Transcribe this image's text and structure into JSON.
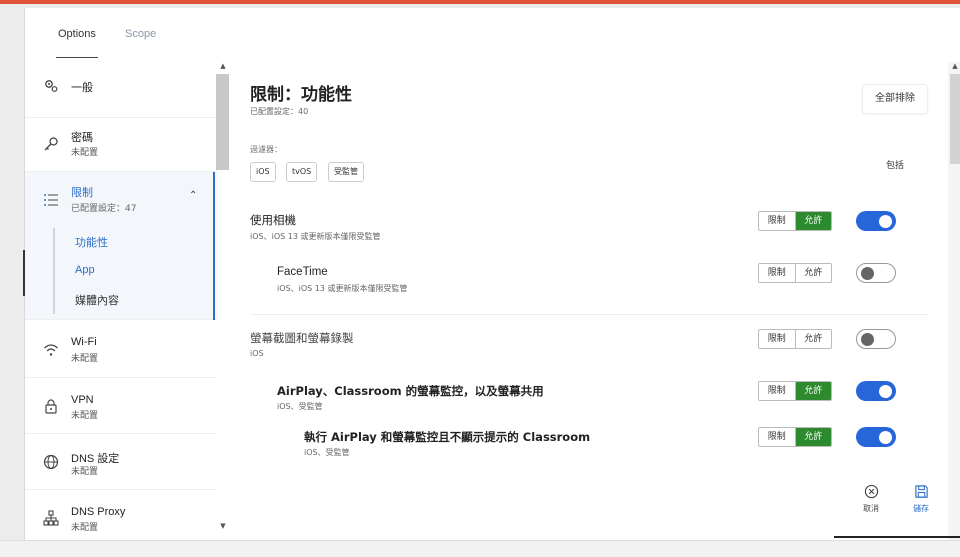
{
  "tabs": {
    "options": "Options",
    "scope": "Scope"
  },
  "sidebar": {
    "items": [
      {
        "title": "一般",
        "sub": "",
        "icon": "gears-icon"
      },
      {
        "title": "密碼",
        "sub": "未配置",
        "icon": "key-icon"
      },
      {
        "title": "限制",
        "sub": "已配置設定：47",
        "icon": "list-icon"
      },
      {
        "title": "Wi-Fi",
        "sub": "未配置",
        "icon": "wifi-icon"
      },
      {
        "title": "VPN",
        "sub": "未配置",
        "icon": "lock-icon"
      },
      {
        "title": "DNS 設定",
        "sub": "未配置",
        "icon": "globe-icon"
      },
      {
        "title": "DNS Proxy",
        "sub": "未配置",
        "icon": "network-icon"
      }
    ],
    "sub_items": [
      "功能性",
      "App",
      "媒體內容"
    ]
  },
  "main": {
    "title": "限制：功能性",
    "subtitle": "已配置設定：40",
    "clear_all": "全部排除",
    "filter_label": "過濾器：",
    "filters": [
      "iOS",
      "tvOS",
      "受監管"
    ],
    "include_label": "包括",
    "restrict_label": "限制",
    "allow_label": "允許",
    "rows": [
      {
        "title": "使用相機",
        "sub": "iOS、iOS 13 或更新版本僅限受監管",
        "allow": true,
        "include": true
      },
      {
        "title": "FaceTime",
        "sub": "iOS、iOS 13 或更新版本僅限受監管",
        "allow": false,
        "include": false
      },
      {
        "title": "螢幕截圖和螢幕錄製",
        "sub": "iOS",
        "allow": false,
        "include": false
      },
      {
        "title": "AirPlay、Classroom 的螢幕監控，以及螢幕共用",
        "sub": "iOS、受監管",
        "allow": true,
        "include": true
      },
      {
        "title": "執行 AirPlay 和螢幕監控且不顯示提示的 Classroom",
        "sub": "iOS、受監管",
        "allow": true,
        "include": true
      }
    ]
  },
  "actions": {
    "cancel": "取消",
    "save": "儲存"
  },
  "colors": {
    "accent": "#2d6dc6",
    "allow_green": "#2d8a2e",
    "toggle_blue": "#2766d8",
    "top_bar": "#e0533a"
  }
}
